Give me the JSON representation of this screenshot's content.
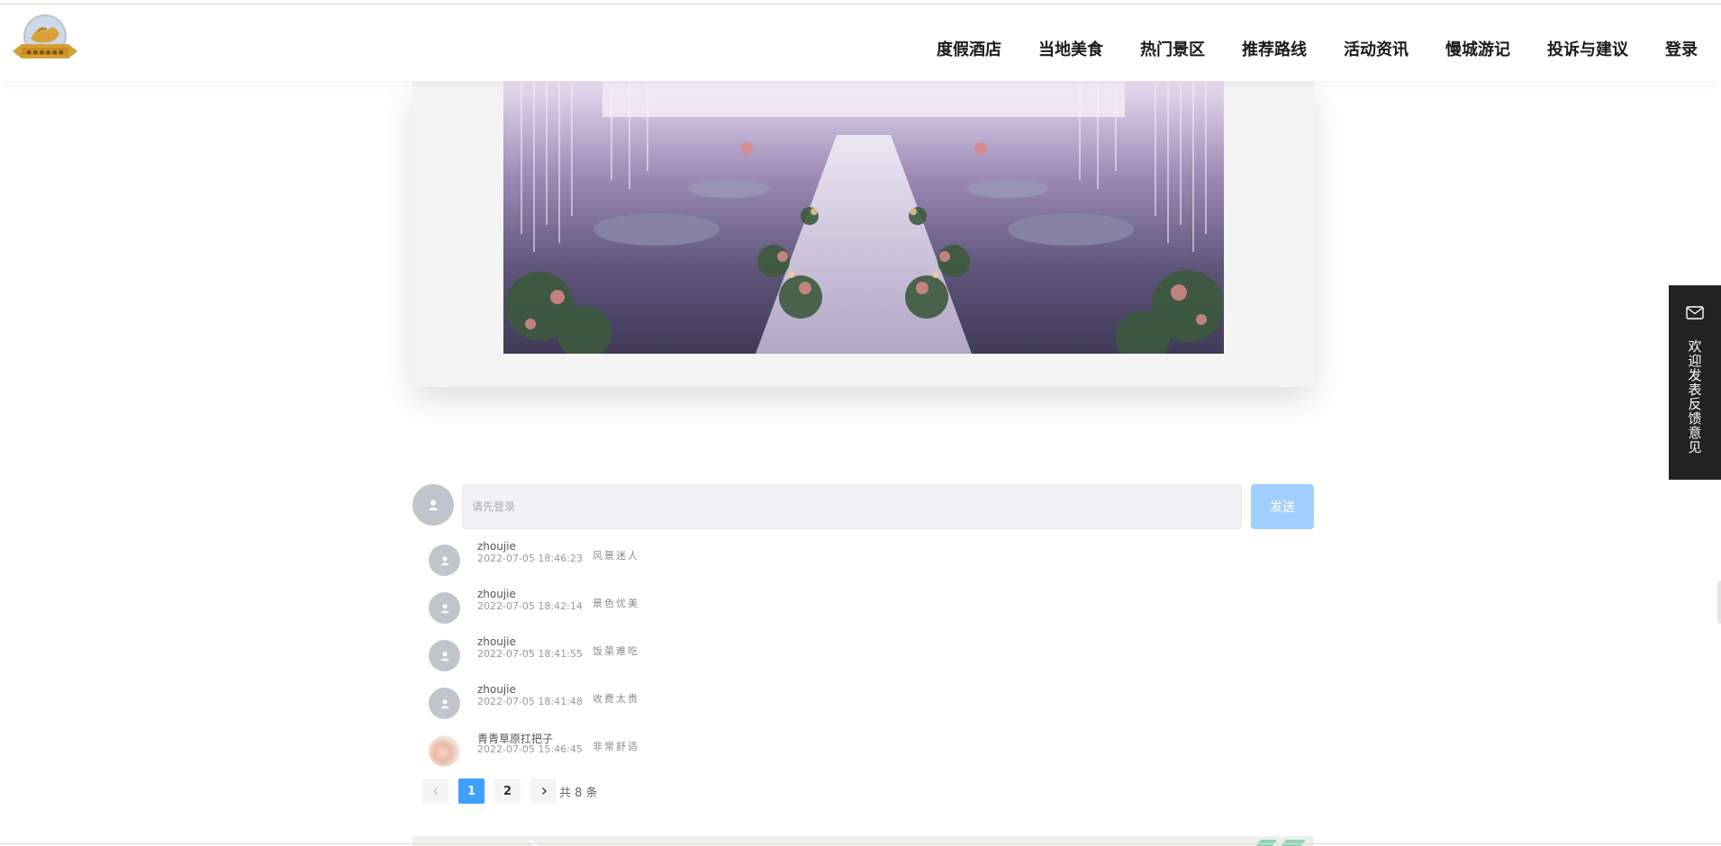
{
  "nav": {
    "items": [
      {
        "label": "度假酒店"
      },
      {
        "label": "当地美食"
      },
      {
        "label": "热门景区"
      },
      {
        "label": "推荐路线"
      },
      {
        "label": "活动资讯"
      },
      {
        "label": "慢城游记"
      },
      {
        "label": "投诉与建议"
      },
      {
        "label": "登录"
      }
    ]
  },
  "logo": {
    "icon": "logo-emblem"
  },
  "comment_box": {
    "placeholder": "请先登录",
    "value": "",
    "send_label": "发送"
  },
  "comments": [
    {
      "user": "zhoujie",
      "time": "2022-07-05 18:46:23",
      "text": "风景迷人"
    },
    {
      "user": "zhoujie",
      "time": "2022-07-05 18:42:14",
      "text": "景色优美"
    },
    {
      "user": "zhoujie",
      "time": "2022-07-05 18:41:55",
      "text": "饭菜难吃"
    },
    {
      "user": "zhoujie",
      "time": "2022-07-05 18:41:48",
      "text": "收费太贵"
    },
    {
      "user": "青青草原扛把子",
      "time": "2022-07-05 15:46:45",
      "text": "非常舒适"
    }
  ],
  "pagination": {
    "prev_icon": "chevron-left-icon",
    "pages": [
      "1",
      "2"
    ],
    "current": "1",
    "next_icon": "chevron-right-icon",
    "total": "共 8 条"
  },
  "feedback": {
    "icon": "mail-icon",
    "label": "欢迎发表反馈意见"
  },
  "colors": {
    "primary": "#409eff",
    "send_disabled": "#a0cfff",
    "feedback_bg": "#222222"
  }
}
